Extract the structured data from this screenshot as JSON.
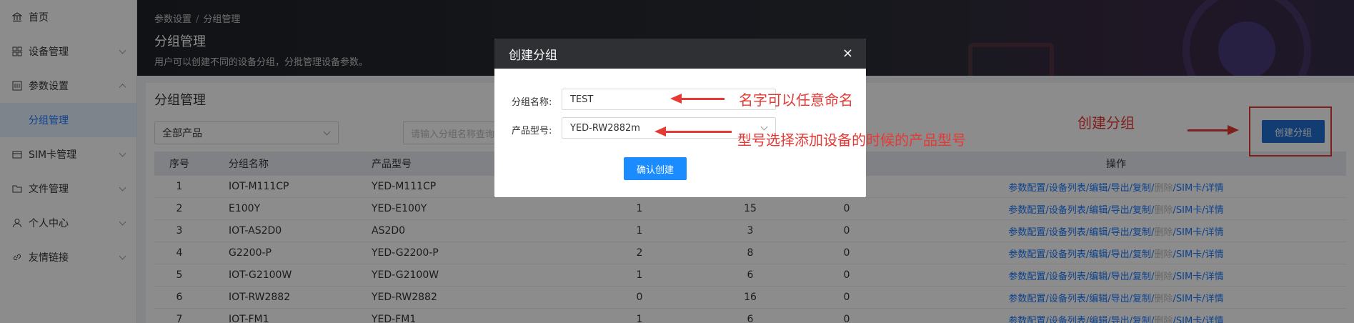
{
  "sidebar": {
    "items": [
      {
        "label": "首页",
        "icon": "bank-icon"
      },
      {
        "label": "设备管理",
        "icon": "grid-icon"
      },
      {
        "label": "参数设置",
        "icon": "settings-panel-icon"
      },
      {
        "label": "SIM卡管理",
        "icon": "card-icon"
      },
      {
        "label": "文件管理",
        "icon": "folder-icon"
      },
      {
        "label": "个人中心",
        "icon": "user-icon"
      },
      {
        "label": "友情链接",
        "icon": "link-icon"
      }
    ],
    "sub_active": "分组管理"
  },
  "header": {
    "breadcrumb": [
      "参数设置",
      "分组管理"
    ],
    "breadcrumb_sep": "/",
    "title": "分组管理",
    "description": "用户可以创建不同的设备分组，分批管理设备参数。"
  },
  "main": {
    "title": "分组管理",
    "product_select": "全部产品",
    "search_placeholder": "请输入分组名称查询",
    "create_button": "创建分组",
    "columns": [
      "序号",
      "分组名称",
      "产品型号",
      "",
      "",
      "",
      "操作"
    ],
    "rows": [
      {
        "idx": "1",
        "name": "IOT-M111CP",
        "model": "YED-M111CP",
        "n1": "",
        "n2": "",
        "n3": ""
      },
      {
        "idx": "2",
        "name": "E100Y",
        "model": "YED-E100Y",
        "n1": "1",
        "n2": "15",
        "n3": "0"
      },
      {
        "idx": "3",
        "name": "IOT-AS2D0",
        "model": "AS2D0",
        "n1": "1",
        "n2": "3",
        "n3": "0"
      },
      {
        "idx": "4",
        "name": "G2200-P",
        "model": "YED-G2200-P",
        "n1": "2",
        "n2": "8",
        "n3": "0"
      },
      {
        "idx": "5",
        "name": "IOT-G2100W",
        "model": "YED-G2100W",
        "n1": "1",
        "n2": "6",
        "n3": "0"
      },
      {
        "idx": "6",
        "name": "IOT-RW2882",
        "model": "YED-RW2882",
        "n1": "0",
        "n2": "16",
        "n3": "0"
      },
      {
        "idx": "7",
        "name": "IOT-FM1",
        "model": "YED-FM1",
        "n1": "1",
        "n2": "6",
        "n3": "0"
      }
    ],
    "ops": {
      "config": "参数配置",
      "devices": "设备列表",
      "edit": "编辑",
      "export": "导出",
      "copy": "复制",
      "delete": "删除",
      "sim": "SIM卡",
      "detail": "详情",
      "sep": "/"
    }
  },
  "modal": {
    "title": "创建分组",
    "close": "×",
    "name_label": "分组名称:",
    "name_value": "TEST",
    "model_label": "产品型号:",
    "model_value": "YED-RW2882m",
    "confirm": "确认创建"
  },
  "annotations": {
    "name_note": "名字可以任意命名",
    "model_note": "型号选择添加设备的时候的产品型号",
    "create_note": "创建分组"
  },
  "colors": {
    "primary": "#1677ff",
    "annotation": "#e53935",
    "header_bg": "#2f3033"
  }
}
